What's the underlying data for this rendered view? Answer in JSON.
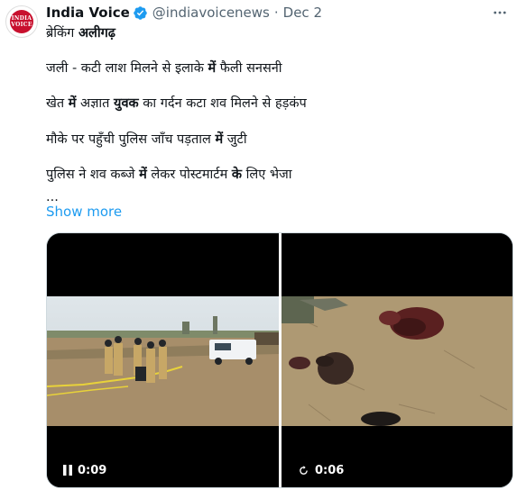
{
  "tweet": {
    "author_name": "India Voice",
    "author_handle": "@indiavoicenews",
    "separator": "·",
    "date": "Dec 2",
    "avatar_text_line1": "INDIA",
    "avatar_text_line2": "VOICE",
    "more_icon": "more-icon",
    "verified_color": "#1d9bf0",
    "lines": [
      {
        "parts": [
          "ब्रेकिंग ",
          "अलीगढ़"
        ]
      },
      {
        "parts": [
          "जली - कटी लाश मिलने से इलाके ",
          "में",
          " फैली सनसनी"
        ]
      },
      {
        "parts": [
          "खेत ",
          "में",
          " अज्ञात ",
          "युवक",
          " का गर्दन कटा शव मिलने से हड़कंप"
        ]
      },
      {
        "parts": [
          "मौके पर पहुँची पुलिस जाँच पड़ताल ",
          "में",
          " जुटी"
        ]
      },
      {
        "parts": [
          "पुलिस ने शव कब्जे ",
          "में",
          " लेकर पोस्टमार्टम ",
          "के",
          " लिए भेजा"
        ]
      }
    ],
    "ellipsis": "...",
    "show_more": "Show more",
    "link_color": "#1d9bf0",
    "videos": [
      {
        "duration": "0:09",
        "control_icon": "pause-icon"
      },
      {
        "duration": "0:06",
        "control_icon": "replay-icon"
      }
    ]
  }
}
